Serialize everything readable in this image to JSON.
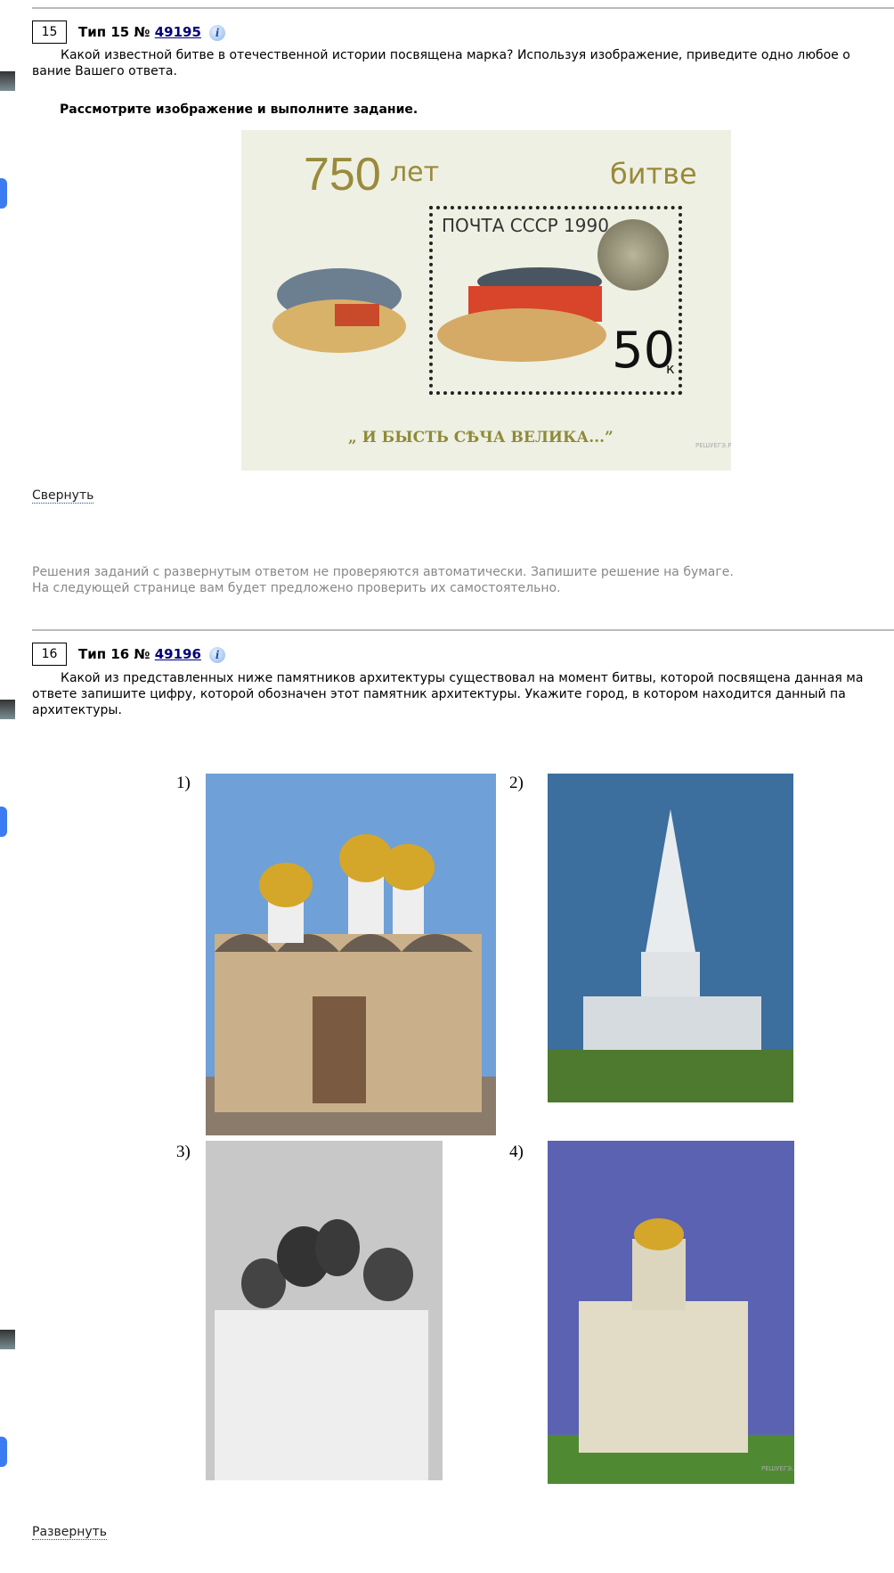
{
  "task15": {
    "number": "15",
    "type_label": "Тип 15 №",
    "id": "49195",
    "info_icon": "i",
    "question_line1": "Какой известной битве в отечественной истории посвящена марка? Используя изображение, приведите одно любое о",
    "question_line2": "вание Вашего ответа.",
    "instruction": "Рассмотрите изображение и выполните задание.",
    "stamp": {
      "title_number": "750",
      "title_word1": "лет",
      "title_word2": "битве",
      "post": "ПОЧТА СССР 1990",
      "value": "50",
      "currency": "к",
      "motto": "„ И БЫСТЬ СѢЧА ВЕЛИКА...”",
      "watermark": "РЕШУЕГЭ.РФ"
    },
    "toggle": "Свернуть",
    "note_line1": "Решения заданий с развернутым ответом не проверяются автоматически. Запишите решение на бумаге.",
    "note_line2": "На следующей странице вам будет предложено проверить их самостоятельно."
  },
  "task16": {
    "number": "16",
    "type_label": "Тип 16 №",
    "id": "49196",
    "info_icon": "i",
    "question_line1": "Какой из представленных ниже памятников архитектуры существовал на момент битвы, которой посвящена данная ма",
    "question_line2": "ответе запишите цифру, которой обозначен этот памятник архитектуры. Укажите город, в котором находится данный па",
    "question_line3": "архитектуры.",
    "options": [
      "1)",
      "2)",
      "3)",
      "4)"
    ],
    "watermark": "РЕШУЕГЭ.РФ",
    "toggle": "Развернуть"
  }
}
